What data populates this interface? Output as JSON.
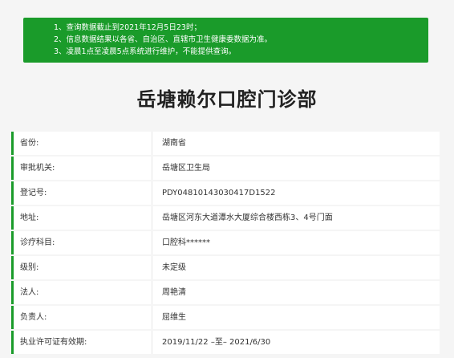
{
  "notice": {
    "lines": [
      "1、查询数据截止到2021年12月5日23时；",
      "2、信息数据结果以各省、自治区、直辖市卫生健康委数据为准。",
      "3、凌晨1点至凌晨5点系统进行维护，不能提供查询。"
    ]
  },
  "clinic": {
    "name": "岳塘赖尔口腔门诊部"
  },
  "details": [
    {
      "label": "省份:",
      "value": "湖南省"
    },
    {
      "label": "审批机关:",
      "value": "岳塘区卫生局"
    },
    {
      "label": "登记号:",
      "value": "PDY04810143030417D1522"
    },
    {
      "label": "地址:",
      "value": "岳塘区河东大道潭水大厦综合楼西栋3、4号门面"
    },
    {
      "label": "诊疗科目:",
      "value": "口腔科******"
    },
    {
      "label": "级别:",
      "value": "未定级"
    },
    {
      "label": "法人:",
      "value": "周艳清"
    },
    {
      "label": "负责人:",
      "value": "屈维生"
    },
    {
      "label": "执业许可证有效期:",
      "value": "2019/11/22 –至– 2021/6/30"
    }
  ],
  "colors": {
    "accent": "#1a9b2a",
    "background": "#f5f5f5",
    "row_background": "#ffffff",
    "text": "#333333",
    "title": "#222222"
  }
}
